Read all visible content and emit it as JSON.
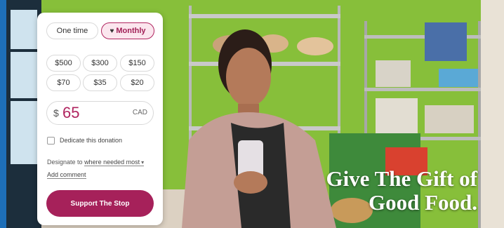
{
  "form": {
    "frequency": {
      "once_label": "One time",
      "monthly_label": "Monthly",
      "selected": "Monthly"
    },
    "amounts": [
      "$500",
      "$300",
      "$150",
      "$70",
      "$35",
      "$20"
    ],
    "custom_amount": {
      "symbol": "$",
      "value": "65",
      "currency": "CAD"
    },
    "dedicate_label": "Dedicate this donation",
    "designate": {
      "prefix": "Designate to",
      "value": "where needed most"
    },
    "add_comment_label": "Add comment",
    "submit_label": "Support The Stop"
  },
  "hero": {
    "headline_line1": "Give The Gift of",
    "headline_line2": "Good Food."
  },
  "colors": {
    "brand": "#a6215a",
    "selected_bg": "#fbe6ee",
    "side_strip": "#1e6fb8",
    "wall": "#8cc63e"
  },
  "icons": {
    "heart": "heart-icon",
    "chevron": "chevron-down-icon",
    "checkbox": "checkbox-icon"
  }
}
